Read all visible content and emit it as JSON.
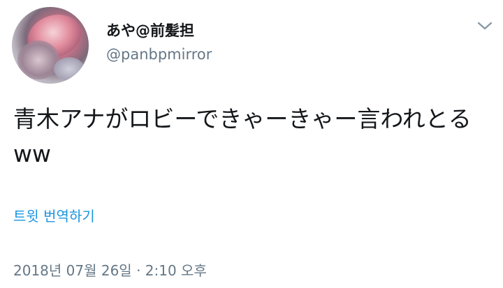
{
  "author": {
    "display_name": "あや@前髪担",
    "screen_name": "@panbpmirror"
  },
  "tweet": {
    "text": "青木アナがロビーできゃーきゃー言われとるww",
    "translate_label": "트윗 번역하기",
    "timestamp": "2018년 07월 26일 · 2:10 오후"
  },
  "icons": {
    "menu": "chevron-down-icon"
  },
  "colors": {
    "text": "#14171a",
    "secondary": "#657786",
    "link": "#1b95e0",
    "background": "#ffffff"
  }
}
